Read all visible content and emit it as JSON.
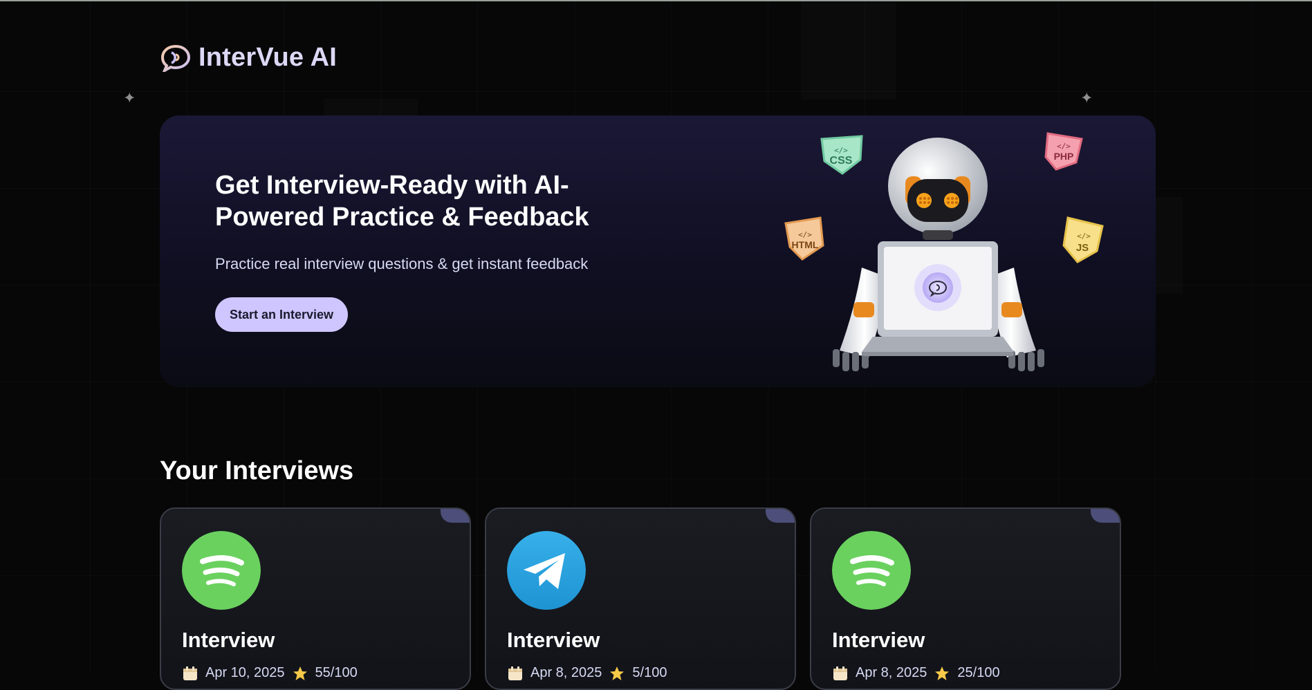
{
  "app": {
    "name": "InterVue AI"
  },
  "hero": {
    "title": "Get Interview-Ready with AI-Powered Practice & Feedback",
    "subtitle": "Practice real interview questions & get instant feedback",
    "cta_label": "Start an Interview",
    "badges": [
      "CSS",
      "PHP",
      "HTML",
      "JS"
    ]
  },
  "interviews": {
    "section_title": "Your Interviews",
    "cards": [
      {
        "title": "Interview",
        "logo": "spotify-logo",
        "date": "Apr 10, 2025",
        "score": "55/100"
      },
      {
        "title": "Interview",
        "logo": "telegram-logo",
        "date": "Apr 8, 2025",
        "score": "5/100"
      },
      {
        "title": "Interview",
        "logo": "spotify-logo",
        "date": "Apr 8, 2025",
        "score": "25/100"
      }
    ]
  },
  "colors": {
    "background": "#070708",
    "accent": "#cfc6ff",
    "brand_text": "#dcd8f5",
    "spotify_green": "#6ad15f",
    "telegram_blue": "#2aa3e0"
  }
}
